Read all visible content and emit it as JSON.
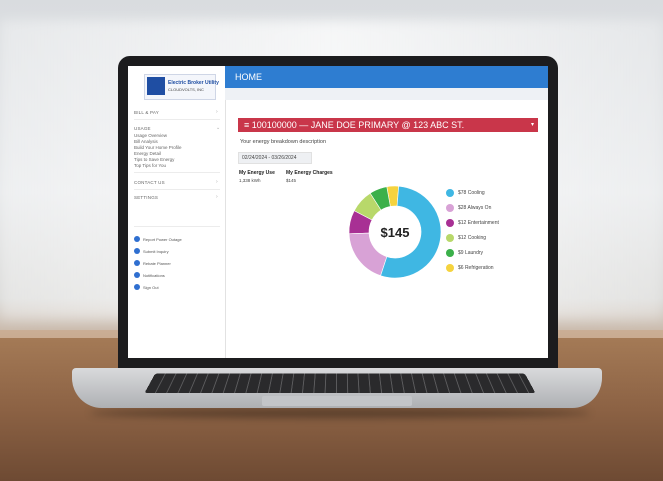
{
  "sidebar": {
    "logo_line1": "Electric Broker Utility",
    "logo_line2": "CLOUDVOLTS, INC",
    "sections": [
      {
        "label": "BILL & PAY"
      },
      {
        "label": "USAGE"
      },
      {
        "label": "CONTACT US"
      },
      {
        "label": "SETTINGS"
      }
    ],
    "usage_links": [
      "Usage Overview",
      "Bill Analysis",
      "Build Your Home Profile",
      "Energy Detail",
      "Tips to Save Energy",
      "Top Tips for You"
    ],
    "quick_links": [
      "Report Power Outage",
      "Submit Inquiry",
      "Rebate Planner",
      "Notifications",
      "Sign Out"
    ]
  },
  "topbar": {
    "title": "HOME"
  },
  "account": {
    "label": "≡ 100100000 — JANE DOE PRIMARY @ 123 ABC ST.",
    "caret": "▾"
  },
  "main": {
    "description": "Your energy breakdown description",
    "date_range": "02/24/2024 - 03/26/2024",
    "energy_use_label": "My Energy Use",
    "energy_use_value": "1,338 kWh",
    "energy_charges_label": "My Energy Charges",
    "energy_charges_value": "$145"
  },
  "chart_data": {
    "type": "pie",
    "center_label": "$145",
    "categories": [
      "Cooling",
      "Always On",
      "Entertainment",
      "Cooking",
      "Laundry",
      "Refrigeration"
    ],
    "values": [
      78,
      28,
      12,
      12,
      9,
      6
    ],
    "legend_labels": [
      "$78 Cooling",
      "$28 Always On",
      "$12 Entertainment",
      "$12 Cooking",
      "$9 Laundry",
      "$6 Refrigeration"
    ],
    "colors": [
      "#3fb7e3",
      "#d8a2d6",
      "#a83094",
      "#b8d86a",
      "#3bb04a",
      "#f5d33e"
    ],
    "legend_position": "right"
  }
}
